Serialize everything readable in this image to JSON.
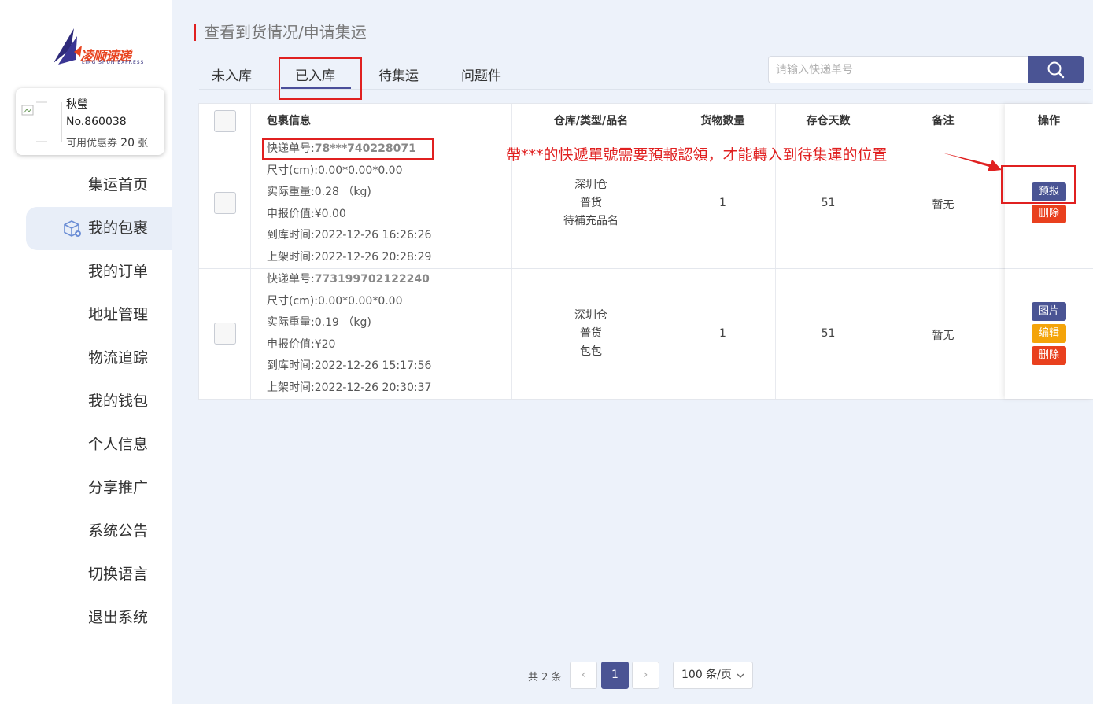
{
  "brand": {
    "logo_text": "凌顺速递",
    "logo_sub": "LING SHUN EXPRESS",
    "colors": {
      "primary": "#4a5494",
      "accent_red": "#e02020",
      "delete": "#e9401e",
      "edit": "#f4a40a"
    }
  },
  "user": {
    "name": "秋瑩",
    "number": "No.860038",
    "coupon_label": "可用优惠券",
    "coupon_count": "20",
    "coupon_unit": "张"
  },
  "sidebar": {
    "items": [
      {
        "label": "集运首页"
      },
      {
        "label": "我的包裹",
        "icon": "package-icon",
        "active": true
      },
      {
        "label": "我的订单"
      },
      {
        "label": "地址管理"
      },
      {
        "label": "物流追踪"
      },
      {
        "label": "我的钱包"
      },
      {
        "label": "个人信息"
      },
      {
        "label": "分享推广"
      },
      {
        "label": "系统公告"
      },
      {
        "label": "切换语言"
      },
      {
        "label": "退出系统"
      }
    ]
  },
  "page": {
    "title": "查看到货情况/申请集运",
    "tabs": [
      {
        "label": "未入库"
      },
      {
        "label": "已入库",
        "active": true
      },
      {
        "label": "待集运"
      },
      {
        "label": "问题件"
      }
    ],
    "search": {
      "placeholder": "请输入快递单号",
      "icon": "search-icon"
    }
  },
  "table": {
    "headers": {
      "info": "包裹信息",
      "warehouse": "仓库/类型/品名",
      "qty": "货物数量",
      "days": "存仓天数",
      "remark": "备注",
      "ops": "操作"
    },
    "labels": {
      "tracking": "快递单号:",
      "size": "尺寸(cm):",
      "weight": "实际重量:",
      "value": "申报价值:",
      "arrival": "到库时间:",
      "shelf": "上架时间:"
    },
    "rows": [
      {
        "tracking": "78***740228071",
        "size": "0.00*0.00*0.00",
        "weight": "0.28 （kg)",
        "value": "¥0.00",
        "arrival": "2022-12-26 16:26:26",
        "shelf": "2022-12-26 20:28:29",
        "warehouse": "深圳仓",
        "type": "普货",
        "product": "待補充品名",
        "qty": "1",
        "days": "51",
        "remark": "暂无",
        "actions": [
          "预报",
          "删除"
        ]
      },
      {
        "tracking": "773199702122240",
        "size": "0.00*0.00*0.00",
        "weight": "0.19 （kg)",
        "value": "¥20",
        "arrival": "2022-12-26 15:17:56",
        "shelf": "2022-12-26 20:30:37",
        "warehouse": "深圳仓",
        "type": "普货",
        "product": "包包",
        "qty": "1",
        "days": "51",
        "remark": "暂无",
        "actions": [
          "图片",
          "编辑",
          "删除"
        ]
      }
    ]
  },
  "annotation": "帶***的快遞單號需要預報認領，才能轉入到待集運的位置",
  "pagination": {
    "total": "共 2 条",
    "prev": "‹",
    "current": "1",
    "next": "›",
    "page_size": "100 条/页"
  }
}
